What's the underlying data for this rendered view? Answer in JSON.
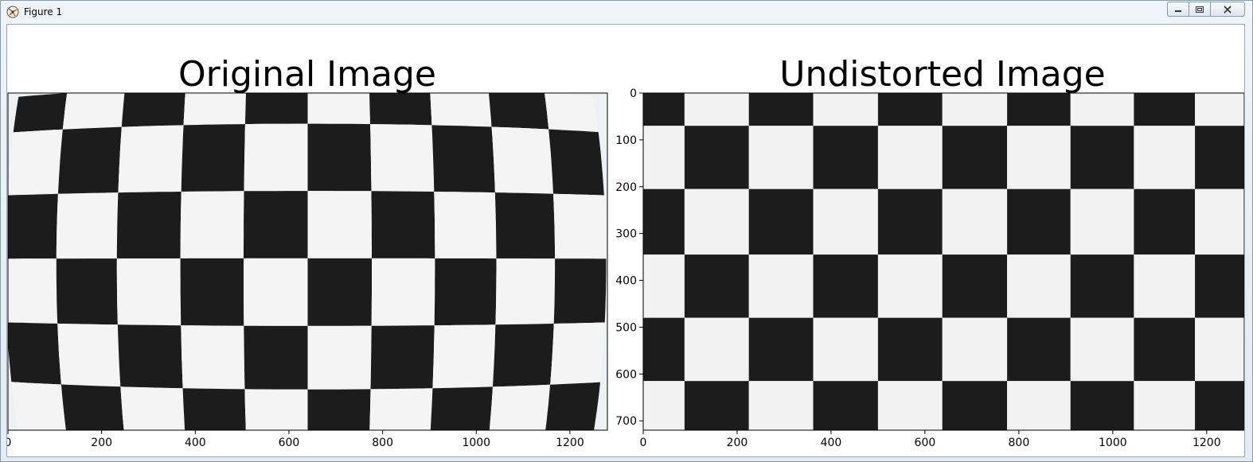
{
  "window": {
    "title": "Figure 1",
    "controls": [
      "minimize",
      "restore",
      "close"
    ]
  },
  "chart_data": [
    {
      "type": "image",
      "title": "Original Image",
      "xticks": [
        "0",
        "200",
        "400",
        "600",
        "800",
        "1000",
        "1200"
      ],
      "xlim": [
        0,
        1280
      ],
      "ylim": [
        720,
        0
      ],
      "yticks": []
    },
    {
      "type": "image",
      "title": "Undistorted Image",
      "xticks": [
        "0",
        "200",
        "400",
        "600",
        "800",
        "1000",
        "1200"
      ],
      "yticks": [
        "0",
        "100",
        "200",
        "300",
        "400",
        "500",
        "600",
        "700"
      ],
      "xlim": [
        0,
        1280
      ],
      "ylim": [
        720,
        0
      ]
    }
  ]
}
